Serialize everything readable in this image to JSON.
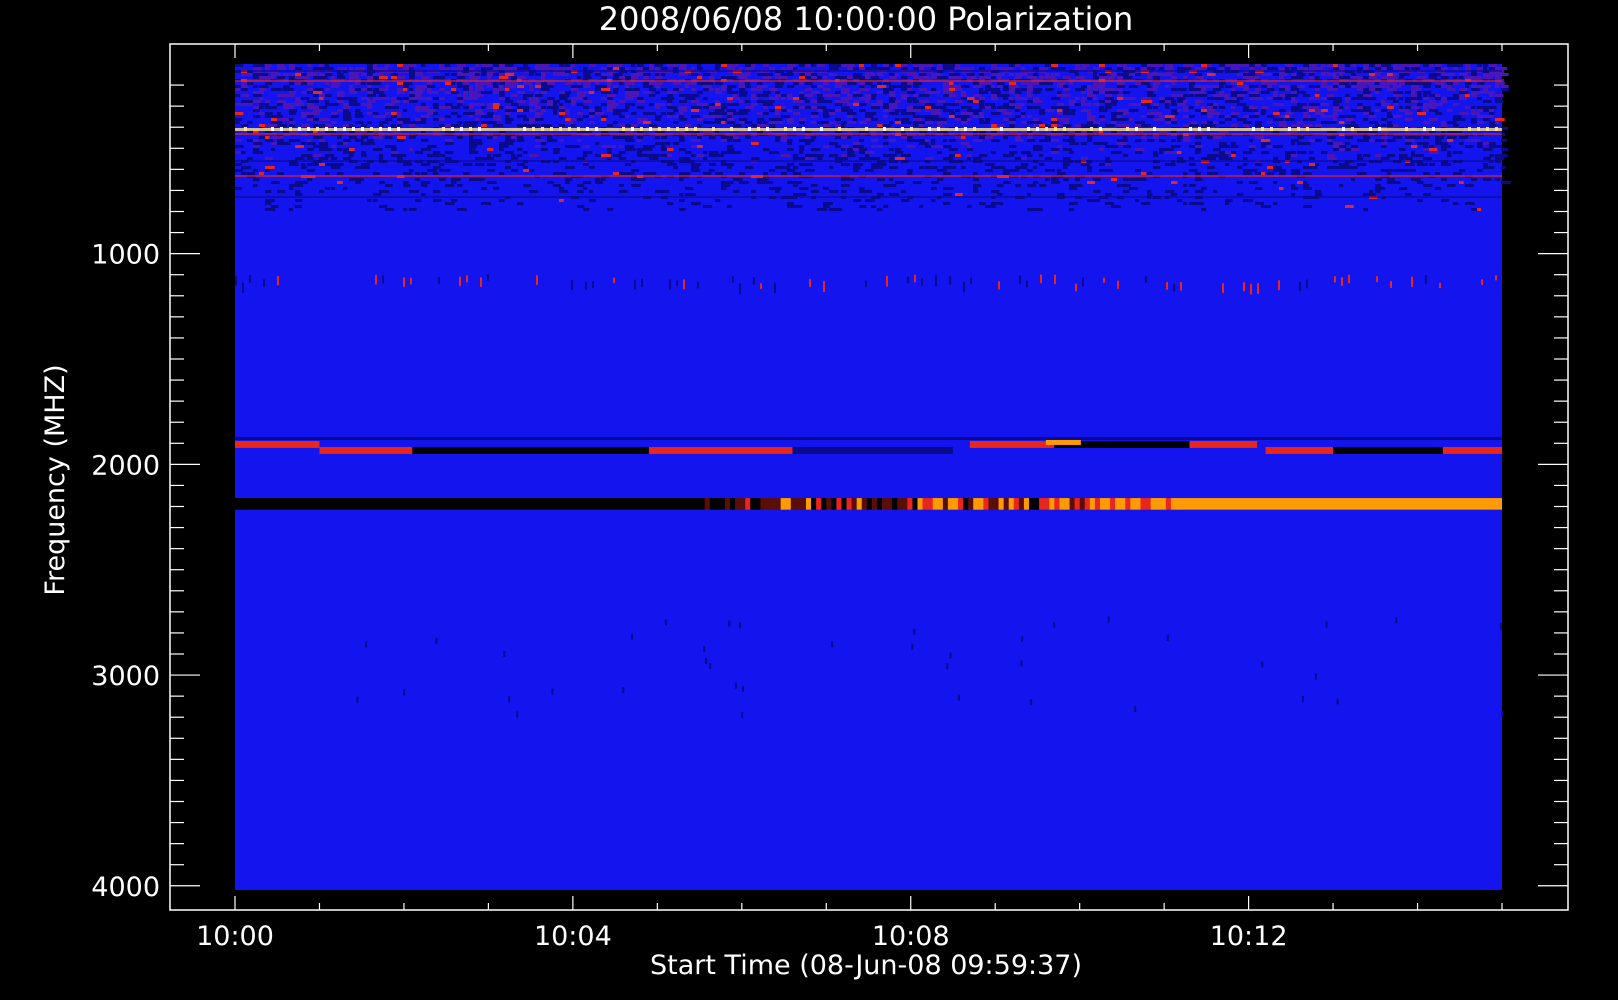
{
  "chart_data": {
    "type": "heatmap",
    "title": "2008/06/08 10:00:00 Polarization",
    "xlabel": "Start Time (08-Jun-08 09:59:37)",
    "ylabel": "Frequency (MHZ)",
    "x_tick_labels": [
      "10:00",
      "10:04",
      "10:08",
      "10:12"
    ],
    "x_tick_values_min": [
      0,
      4,
      8,
      12
    ],
    "x_range_min": [
      0,
      15
    ],
    "y_tick_labels": [
      "1000",
      "2000",
      "3000",
      "4000"
    ],
    "y_tick_values": [
      1000,
      2000,
      3000,
      4000
    ],
    "y_range": [
      100,
      4020
    ],
    "y_inverted": true,
    "background_color": "#1414ee",
    "colors": {
      "background": "#000000",
      "axes": "#ffffff",
      "field": "#1414ee",
      "noise_dark": "#0a0a8c",
      "noise_purple": "#4a16b8",
      "red": "#e8261a",
      "orange": "#ff9a00",
      "yellow": "#ffe680",
      "black": "#000000"
    },
    "bands": [
      {
        "name": "rfi-top",
        "freq_range": [
          100,
          790
        ],
        "level": "noisy-high"
      },
      {
        "name": "rfi-400",
        "freq_range": [
          395,
          420
        ],
        "level": "bright-speckle"
      },
      {
        "name": "rfi-1100",
        "freq_range": [
          1100,
          1140
        ],
        "level": "sparse-speckle"
      },
      {
        "name": "band-1900",
        "freq_range": [
          1870,
          1950
        ],
        "level": "mixed-red-black"
      },
      {
        "name": "band-2180",
        "freq_range": [
          2160,
          2215
        ],
        "level": "black-to-orange"
      }
    ]
  }
}
